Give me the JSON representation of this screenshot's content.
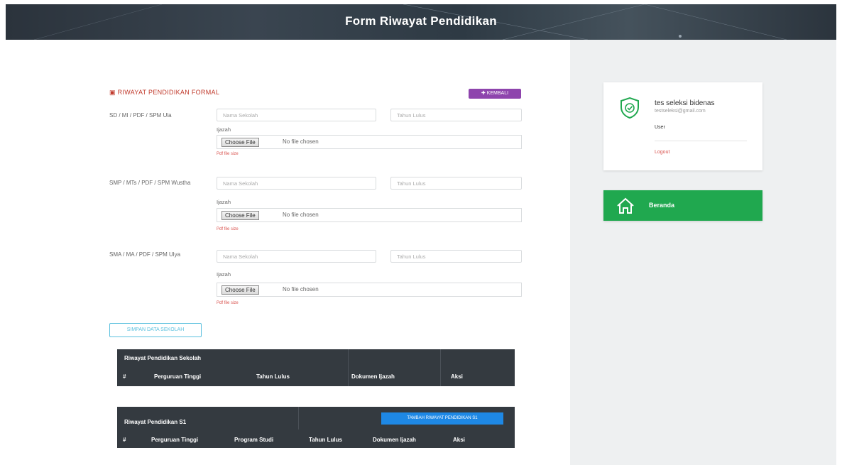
{
  "header": {
    "title": "Form Riwayat Pendidikan"
  },
  "form": {
    "section_title": "RIWAYAT PENDIDIKAN FORMAL",
    "back_label": "KEMBALI",
    "rows": [
      {
        "label": "SD / MI / PDF / SPM Ula",
        "school_placeholder": "Nama Sekolah",
        "year_placeholder": "Tahun Lulus",
        "ijazah_label": "Ijazah",
        "file_button": "Choose File",
        "file_name": "No file chosen",
        "note": "Pdf file size"
      },
      {
        "label": "SMP / MTs / PDF / SPM Wustha",
        "school_placeholder": "Nama Sekolah",
        "year_placeholder": "Tahun Lulus",
        "ijazah_label": "Ijazah",
        "file_button": "Choose File",
        "file_name": "No file chosen",
        "note": "Pdf file size"
      },
      {
        "label": "SMA / MA / PDF / SPM Ulya",
        "school_placeholder": "Nama Sekolah",
        "year_placeholder": "Tahun Lulus",
        "ijazah_label": "Ijazah",
        "file_button": "Choose File",
        "file_name": "No file chosen",
        "note": "Pdf file size"
      }
    ],
    "submit_label": "SIMPAN DATA SEKOLAH"
  },
  "table1": {
    "title": "Riwayat Pendidikan Sekolah",
    "headers": [
      "#",
      "Perguruan Tinggi",
      "Tahun Lulus",
      "Dokumen Ijazah",
      "Aksi"
    ]
  },
  "table2": {
    "title": "Riwayat Pendidikan S1",
    "add_button": "TAMBAH RIWAYAT PENDIDIKAN S1",
    "headers": [
      "#",
      "Perguruan Tinggi",
      "Program Studi",
      "Tahun Lulus",
      "Dokumen Ijazah",
      "Aksi"
    ]
  },
  "profile": {
    "name": "tes seleksi bidenas",
    "email": "testseleksi@gmail.com",
    "role": "User",
    "logout": "Logout",
    "icon": "shield-check-icon"
  },
  "nav": {
    "home_label": "Beranda",
    "icon": "home-icon"
  },
  "colors": {
    "accent_green": "#20a84f",
    "header_dark": "#2b333c",
    "back_purple": "#8e44ad",
    "add_blue": "#1e88e5",
    "section_red": "#c0392b"
  }
}
